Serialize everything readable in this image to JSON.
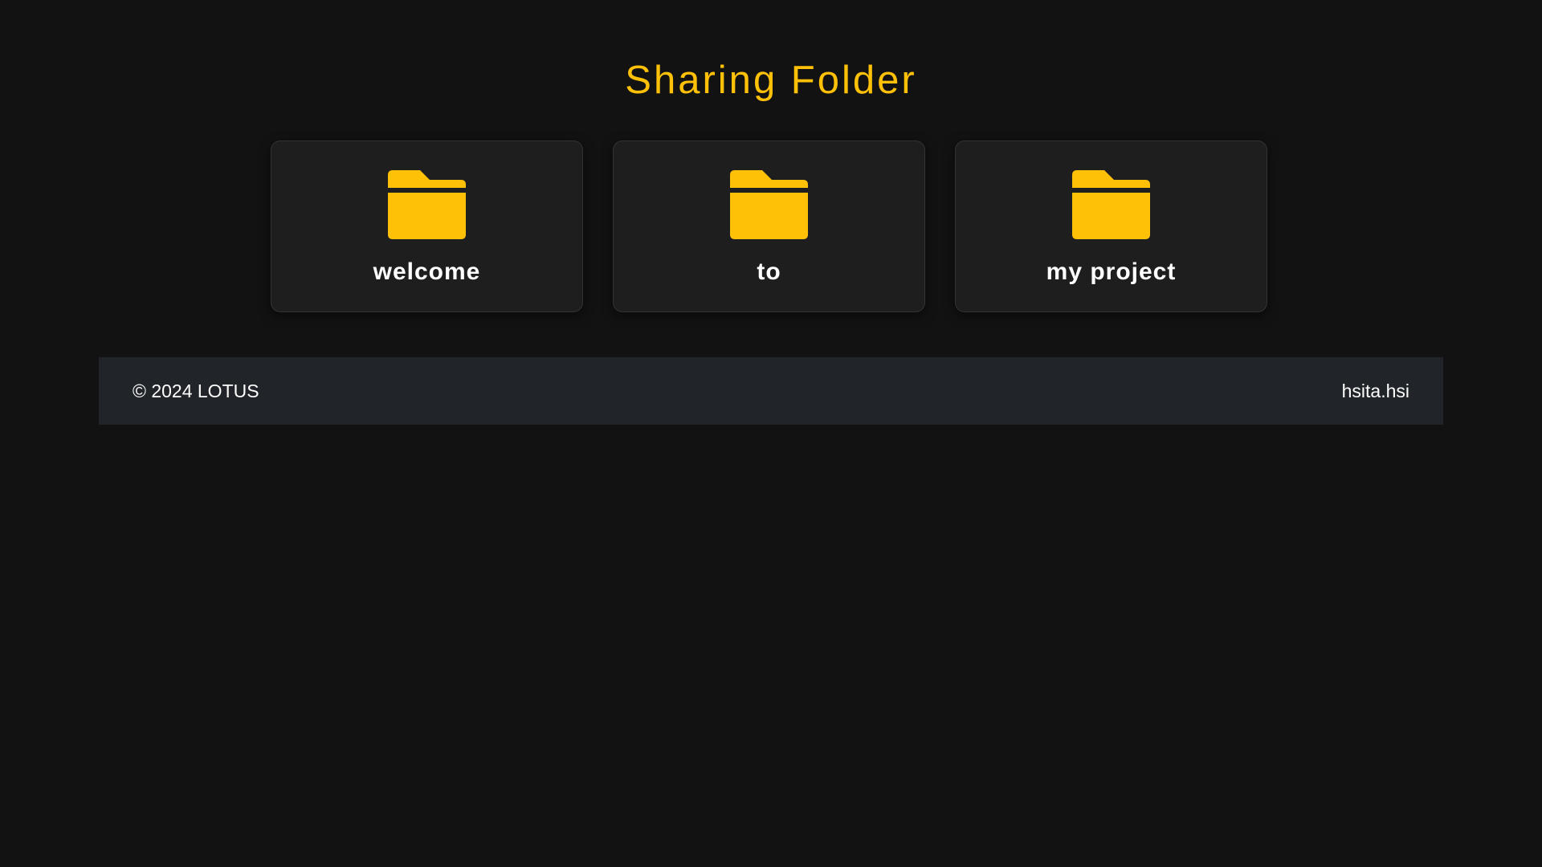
{
  "page": {
    "title": "Sharing Folder"
  },
  "folders": [
    {
      "label": "welcome",
      "icon": "folder-icon"
    },
    {
      "label": "to",
      "icon": "folder-icon"
    },
    {
      "label": "my project",
      "icon": "folder-icon"
    }
  ],
  "footer": {
    "copyright": "© 2024 LOTUS",
    "credit": "hsita.hsi"
  },
  "colors": {
    "accent": "#ffc107",
    "background": "#121212",
    "card": "#1e1e1e",
    "footer": "#212529"
  }
}
